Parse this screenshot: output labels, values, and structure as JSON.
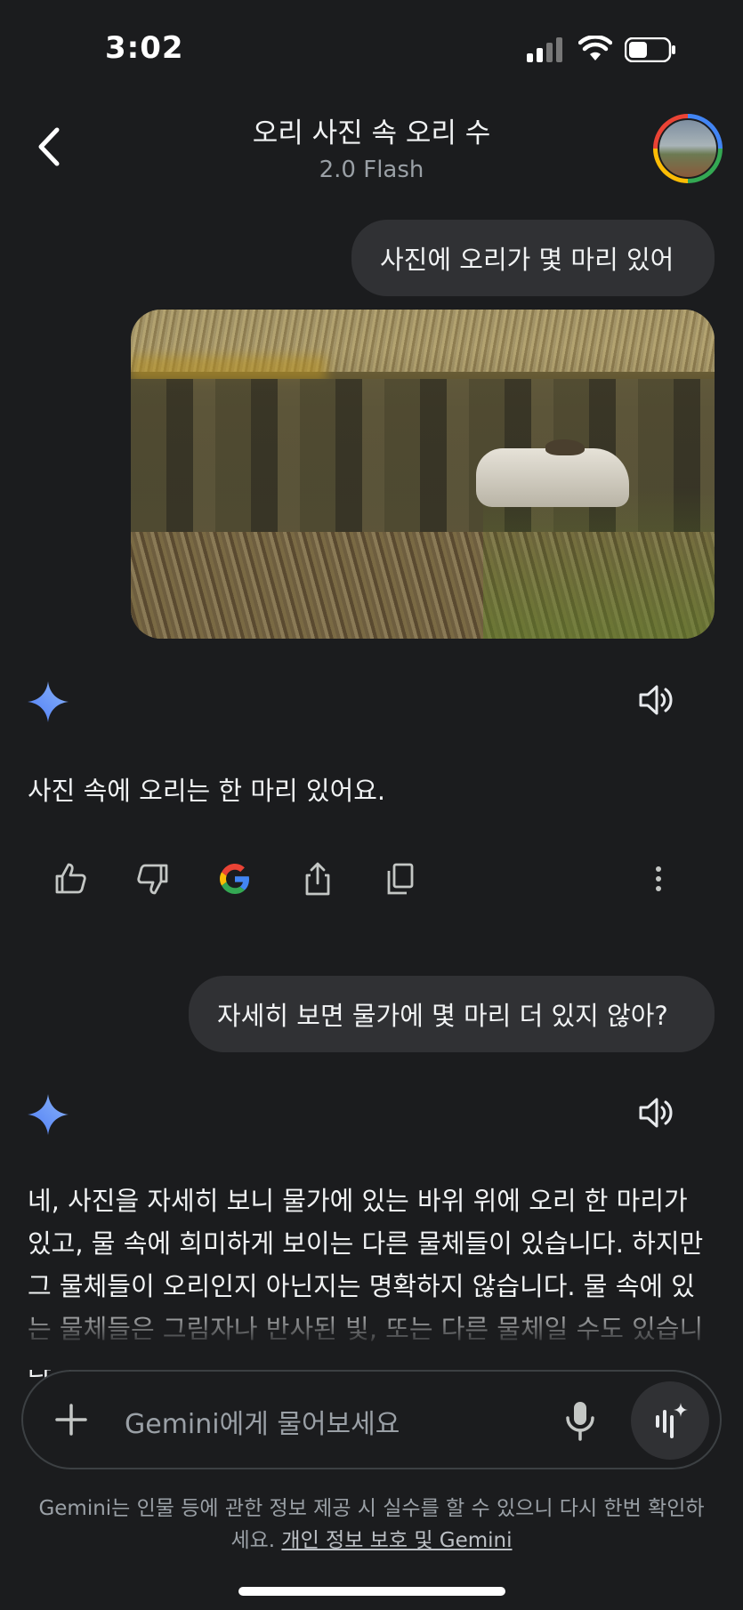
{
  "status_bar": {
    "time": "3:02"
  },
  "header": {
    "title": "오리 사진 속 오리 수",
    "subtitle": "2.0 Flash"
  },
  "messages": {
    "user1": "사진에 오리가 몇 마리 있어",
    "reply1": "사진 속에 오리는 한 마리 있어요.",
    "user2": "자세히 보면 물가에 몇 마리 더 있지 않아?",
    "reply2": "네, 사진을 자세히 보니 물가에 있는 바위 위에 오리 한 마리가 있고, 물 속에 희미하게 보이는 다른 물체들이 있습니다. 하지만 그 물체들이 오리인지 아닌지는 명확하지 않습니다. 물 속에 있는 물체들은 그림자나 반사된 빛, 또는 다른 물체일 수도 있습니다. 따라서 확실하게 몇 쌍 더 있는지 말씀드리기 어렵습니다."
  },
  "input": {
    "placeholder": "Gemini에게 물어보세요"
  },
  "disclaimer": {
    "text": "Gemini는 인물 등에 관한 정보 제공 시 실수를 할 수 있으니 다시 한번 확인하세요.",
    "link": "개인 정보 보호 및 Gemini"
  },
  "icons": {
    "back": "chevron-left-icon",
    "gemini": "gemini-sparkle-icon",
    "speaker": "speaker-icon",
    "thumbs_up": "thumbs-up-icon",
    "thumbs_down": "thumbs-down-icon",
    "google": "google-g-icon",
    "share": "share-icon",
    "copy": "copy-icon",
    "more": "more-vertical-icon",
    "plus": "plus-icon",
    "mic": "mic-icon",
    "live": "live-sparkle-icon"
  }
}
